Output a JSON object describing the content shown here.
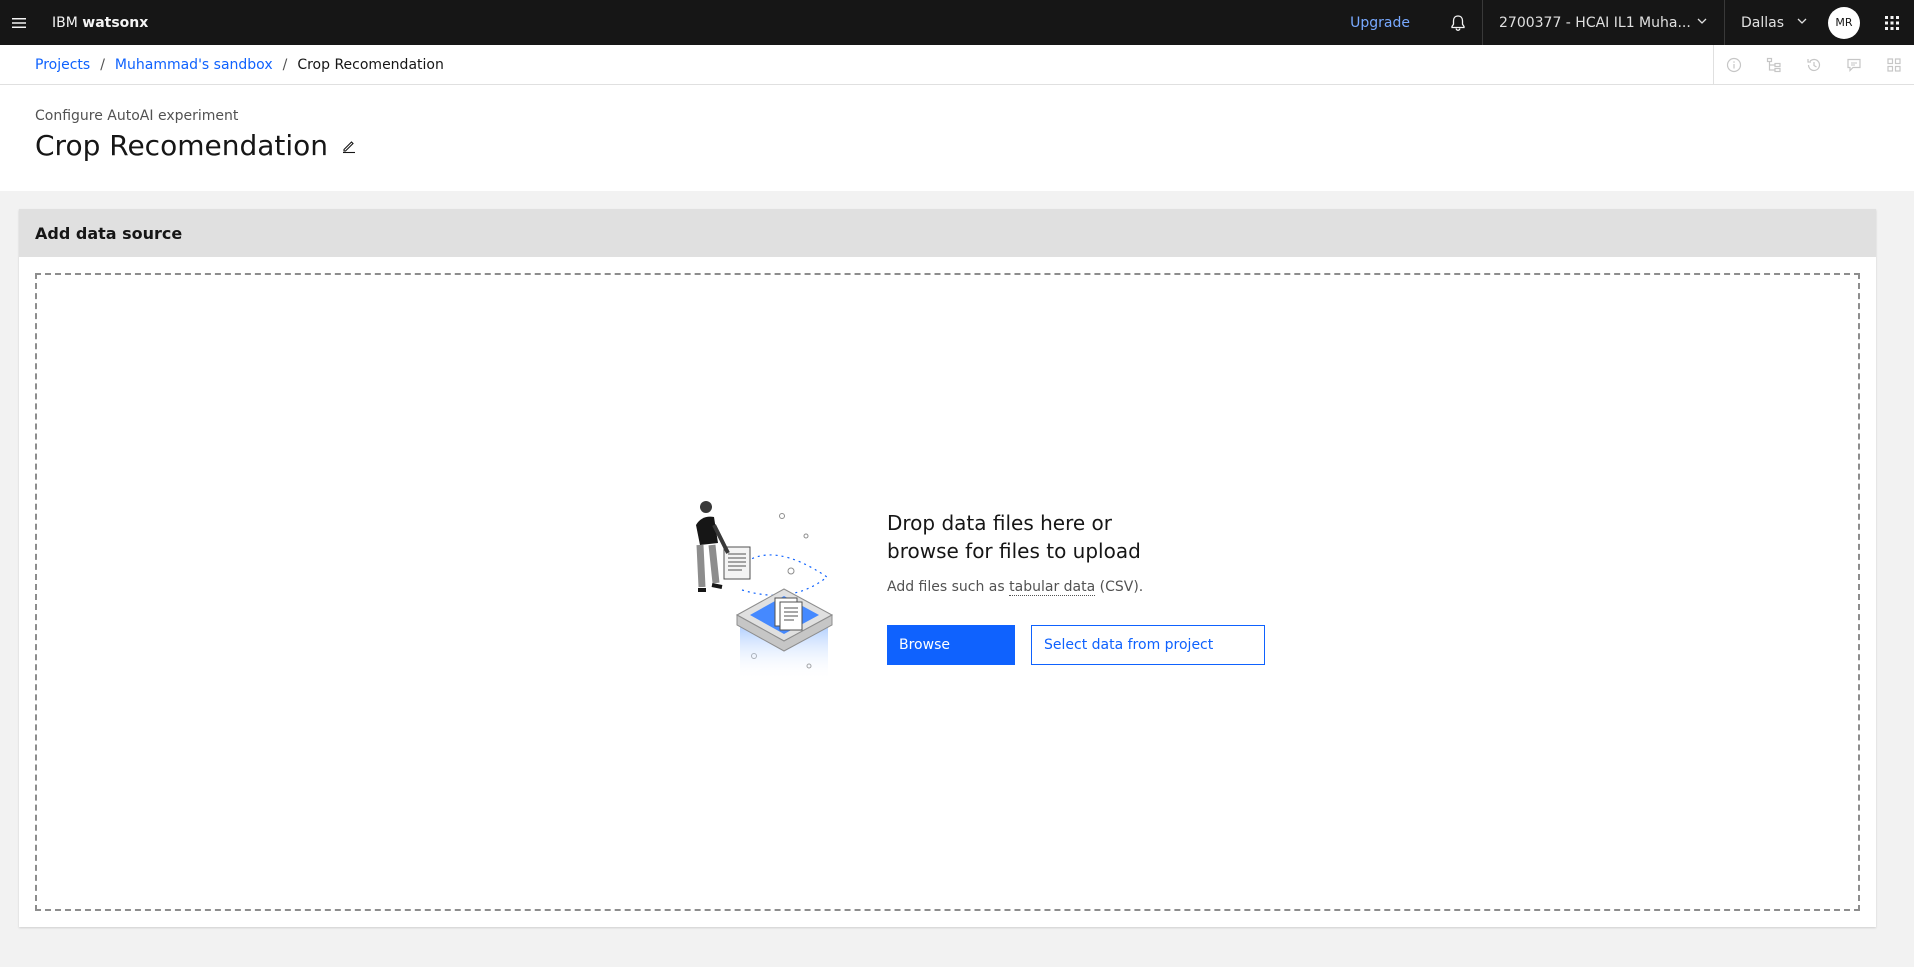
{
  "topbar": {
    "brand_prefix": "IBM",
    "brand_product": "watsonx",
    "upgrade_label": "Upgrade",
    "account_label": "2700377 - HCAI IL1 Muha...",
    "region_label": "Dallas",
    "avatar_initials": "MR"
  },
  "breadcrumb": {
    "items": [
      {
        "label": "Projects"
      },
      {
        "label": "Muhammad's sandbox"
      }
    ],
    "current": "Crop Recomendation",
    "separator": "/"
  },
  "header": {
    "subtitle": "Configure AutoAI experiment",
    "title": "Crop Recomendation"
  },
  "card": {
    "title": "Add data source",
    "drop_heading_line1": "Drop data files here or",
    "drop_heading_line2": "browse for files to upload",
    "drop_sub_prefix": "Add files such as",
    "drop_sub_link": "tabular data",
    "drop_sub_suffix": "(CSV).",
    "browse_label": "Browse",
    "select_label": "Select data from project"
  },
  "colors": {
    "accent": "#0f62fe",
    "topbar_bg": "#161616",
    "upgrade": "#78a9ff"
  },
  "icons": {
    "menu": "hamburger-icon",
    "notifications": "bell-icon",
    "switcher": "app-switcher-icon",
    "edit": "edit-pencil-icon",
    "tools": [
      "info-icon",
      "tree-icon",
      "history-icon",
      "chat-icon",
      "apps-icon"
    ]
  }
}
